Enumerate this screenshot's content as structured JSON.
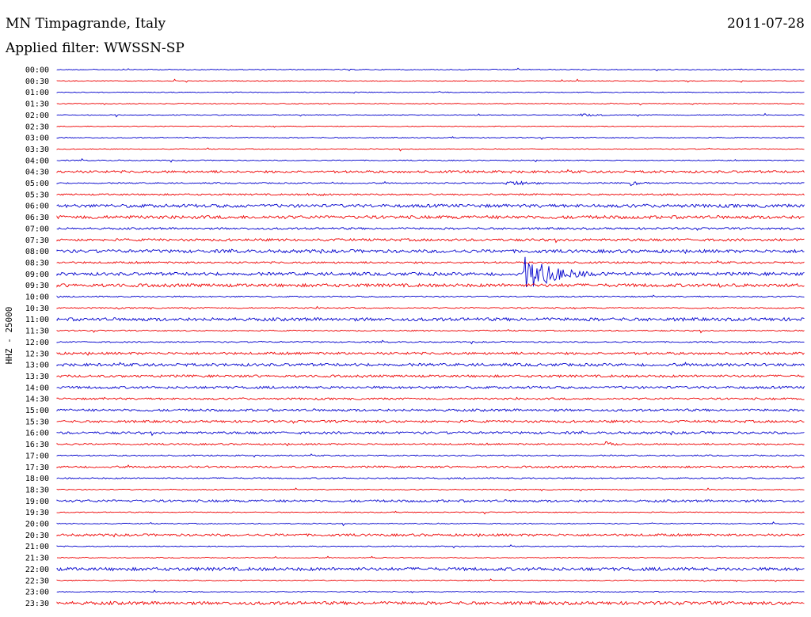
{
  "header": {
    "title": "MN Timpagrande, Italy",
    "date": "2011-07-28",
    "filter": "Applied filter: WWSSN-SP"
  },
  "chart_data": {
    "type": "line",
    "ylabel": "HHZ - 25000",
    "trace_colors": [
      "#0000cc",
      "#ee0000"
    ],
    "row_labels": [
      "00:00",
      "00:30",
      "01:00",
      "01:30",
      "02:00",
      "02:30",
      "03:00",
      "03:30",
      "04:00",
      "04:30",
      "05:00",
      "05:30",
      "06:00",
      "06:30",
      "07:00",
      "07:30",
      "08:00",
      "08:30",
      "09:00",
      "09:30",
      "10:00",
      "10:30",
      "11:00",
      "11:30",
      "12:00",
      "12:30",
      "13:00",
      "13:30",
      "14:00",
      "14:30",
      "15:00",
      "15:30",
      "16:00",
      "16:30",
      "17:00",
      "17:30",
      "18:00",
      "18:30",
      "19:00",
      "19:30",
      "20:00",
      "20:30",
      "21:00",
      "21:30",
      "22:00",
      "22:30",
      "23:00",
      "23:30"
    ],
    "noise_levels": [
      0.5,
      0.5,
      0.5,
      0.5,
      0.5,
      0.5,
      0.6,
      0.5,
      0.6,
      1.5,
      0.8,
      1.0,
      2.0,
      2.0,
      1.2,
      1.5,
      2.0,
      1.2,
      2.0,
      2.0,
      0.8,
      0.8,
      2.0,
      0.8,
      0.8,
      1.5,
      1.8,
      1.5,
      1.5,
      1.2,
      1.5,
      1.5,
      1.5,
      1.0,
      0.8,
      1.2,
      0.8,
      0.6,
      1.5,
      0.6,
      0.6,
      1.5,
      0.6,
      0.6,
      2.0,
      0.6,
      0.6,
      2.0
    ],
    "events": [
      {
        "row": 4,
        "minute": 21,
        "amplitude": 1.2,
        "duration_min": 1
      },
      {
        "row": 10,
        "minute": 18,
        "amplitude": 4,
        "duration_min": 1.6
      },
      {
        "row": 10,
        "minute": 23,
        "amplitude": 3,
        "duration_min": 0.8
      },
      {
        "row": 11,
        "minute": 10,
        "amplitude": 3,
        "duration_min": 1.2
      },
      {
        "row": 15,
        "minute": 28,
        "amplitude": 3,
        "duration_min": 0.5
      },
      {
        "row": 18,
        "minute": 18.7,
        "amplitude": 26,
        "duration_min": 3.4
      },
      {
        "row": 19,
        "minute": 26.5,
        "amplitude": 3,
        "duration_min": 0.6
      },
      {
        "row": 33,
        "minute": 22,
        "amplitude": 3,
        "duration_min": 0.6
      },
      {
        "row": 43,
        "minute": 12.6,
        "amplitude": 2,
        "duration_min": 0.4
      }
    ]
  }
}
